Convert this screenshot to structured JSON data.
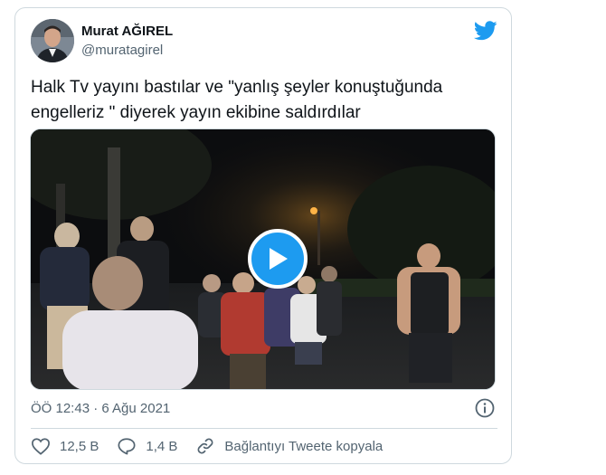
{
  "author": {
    "name": "Murat AĞIREL",
    "handle": "@muratagirel"
  },
  "tweet": {
    "text": "Halk Tv yayını bastılar ve ʺyanlış şeyler konuştuğunda engelleriz ʺ diyerek yayın ekibine saldırdılar",
    "timestamp": "ÖÖ 12:43 · 6 Ağu 2021"
  },
  "actions": {
    "likes": "12,5 B",
    "replies": "1,4 B",
    "copy_link": "Bağlantıyı Tweete kopyala"
  },
  "colors": {
    "accent": "#1d9bf0",
    "secondary_text": "#536471",
    "border": "#cfd9de"
  },
  "icons": [
    "twitter-bird-icon",
    "play-icon",
    "info-icon",
    "heart-icon",
    "reply-icon",
    "link-icon"
  ]
}
